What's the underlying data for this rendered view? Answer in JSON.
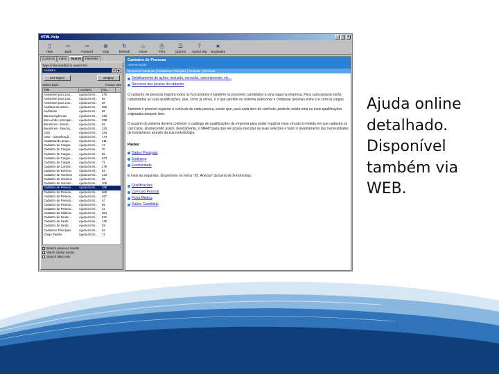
{
  "slide": {
    "caption": [
      "Ajuda online",
      "detalhado.",
      "Disponível",
      "também via",
      "WEB."
    ]
  },
  "window": {
    "title": "HTML Help",
    "controls": [
      "_",
      "□",
      "×"
    ],
    "toolbar": [
      "Hide",
      "Back",
      "Forward",
      "Stop",
      "Refresh",
      "Home",
      "Print",
      "Options",
      "Ajuda Help",
      "Novidades"
    ],
    "tabs": [
      "Contents",
      "Index",
      "Search",
      "Favorites"
    ],
    "search": {
      "prompt": "Type in the word(s) to search for:",
      "value": "cadastro",
      "list_topics": "List Topics",
      "display": "Display",
      "select_topic": "Select topic:",
      "found": "Found: 292"
    },
    "columns": [
      "Title",
      "Location",
      "Ra..."
    ],
    "rows": [
      [
        "Assistente para Lan...",
        "Ajuda do Mi...",
        "279"
      ],
      [
        "Assistente para Lan...",
        "Ajuda do Mi...",
        "55"
      ],
      [
        "Assistente para Lan...",
        "Ajuda do Mi...",
        "59"
      ],
      [
        "Auditoria de altera...",
        "Ajuda do Mi...",
        "388"
      ],
      [
        "Auditorias",
        "Ajuda do Mi...",
        "69"
      ],
      [
        "Bancos/Agências",
        "Ajuda do Mi...",
        "319"
      ],
      [
        "Bem-vindo, prIncIpai...",
        "Ajuda do Mi...",
        "238"
      ],
      [
        "Benefícios - Emiss...",
        "Ajuda do Mi...",
        "62"
      ],
      [
        "Benefícios - Descriç...",
        "Ajuda do Mi...",
        "120"
      ],
      [
        "CBO",
        "Ajuda do Mi...",
        "234"
      ],
      [
        "CBO - Classificaçã...",
        "Ajuda do Mi...",
        "174"
      ],
      [
        "Cadastrando grupo...",
        "Ajuda do Mi...",
        "211"
      ],
      [
        "Cadastro de Cargos",
        "Ajuda do Mi...",
        "74"
      ],
      [
        "Cadastro de Cargos...",
        "Ajuda do Mi...",
        "70"
      ],
      [
        "Cadastro de Cargos...",
        "Ajuda do Mi...",
        "86"
      ],
      [
        "Cadastro de Cargos...",
        "Ajuda do Mi...",
        "673"
      ],
      [
        "Cadastro de Cargos...",
        "Ajuda do Mi...",
        "71"
      ],
      [
        "Cadastro de Control...",
        "Ajuda do Mi...",
        "279"
      ],
      [
        "Cadastro de Eventos",
        "Ajuda do Mi...",
        "63"
      ],
      [
        "Cadastro de Horários",
        "Ajuda do Mi...",
        "142"
      ],
      [
        "Cadastro de Horários",
        "Ajuda do Mi...",
        "25"
      ],
      [
        "Cadastro de Homolo...",
        "Ajuda do Mi...",
        "109"
      ],
      [
        "Cadastro de Pessoa...",
        "Ajuda do Mi...",
        "189"
      ],
      [
        "Cadastro de Pessoa...",
        "Ajuda do Mi...",
        "585"
      ],
      [
        "Cadastro de Pessoa...",
        "Ajuda do Mi...",
        "167"
      ],
      [
        "Cadastro de Pessoa...",
        "Ajuda do Mi...",
        "57"
      ],
      [
        "Cadastro de Pessoa...",
        "Ajuda do Mi...",
        "85"
      ],
      [
        "Cadastro de Pessoa...",
        "Ajuda do Mi...",
        "43"
      ],
      [
        "Cadastro de Salários",
        "Ajuda do Mi...",
        "254"
      ],
      [
        "Cadastro de Sindic...",
        "Ajuda do Mi...",
        "531"
      ],
      [
        "Cadastro de Sindic...",
        "Ajuda do Mi...",
        "130"
      ],
      [
        "Cadastro de Sindic...",
        "Ajuda do Mi...",
        "29"
      ],
      [
        "Cadastros Principais",
        "Ajuda do Mi...",
        "54"
      ],
      [
        "Cargo Padrão",
        "Ajuda do Mi...",
        "71"
      ]
    ],
    "selected_row": 22,
    "options": [
      {
        "label": "Search previous results",
        "checked": false
      },
      {
        "label": "Match similar words",
        "checked": true
      },
      {
        "label": "Search titles only",
        "checked": false
      }
    ],
    "content": {
      "title": "Cadastro de Pessoas",
      "subtitle": "Apresentação",
      "crumb": "Recursos Humanos | Cadastros Principais | Pessoas | Pessoas",
      "link1": "Detalhamento de ações: inclusão, exclusão, cancelamento, etc...",
      "link2": "Recursos das janelas do cadastro",
      "p1": "O cadastro de pessoas registra todos os funcionários e também os possíveis candidatos a uma vaga na empresa. Para cada pessoa serão cadastradas as suas qualificações, que, como já vimos, é o que permite ao sistema selecionar e comparar pessoas entre si e com os cargos.",
      "p2": "Também é possível registrar o currículo de cada pessoa, sendo que, para cada item do currículo, poderão existir uma ou mais qualificações originadas daquele item.",
      "p3": "O usuário do sistema deverá conhecer o catálogo de qualificações da empresa para poder registrar esse vínculo à medida em que cadastra os currículos, abastecendo assim, devidamente, o MikRH para que ele possa executar as suas seleções e fazer o levantamento das necessidades de treinamento através da sua metodologia.",
      "pastas_label": "Pastas:",
      "pastas": [
        "Dados Principais",
        "Endereço",
        "Escolaridade"
      ],
      "p4": "E mais as seguintes, disponíveis no menu \"Inf. Anexas\" da barra de ferramentas:",
      "anexas": [
        "Qualificações",
        "Currículo Pessoal",
        "Ficha Médica",
        "Dados Candidato"
      ]
    }
  }
}
